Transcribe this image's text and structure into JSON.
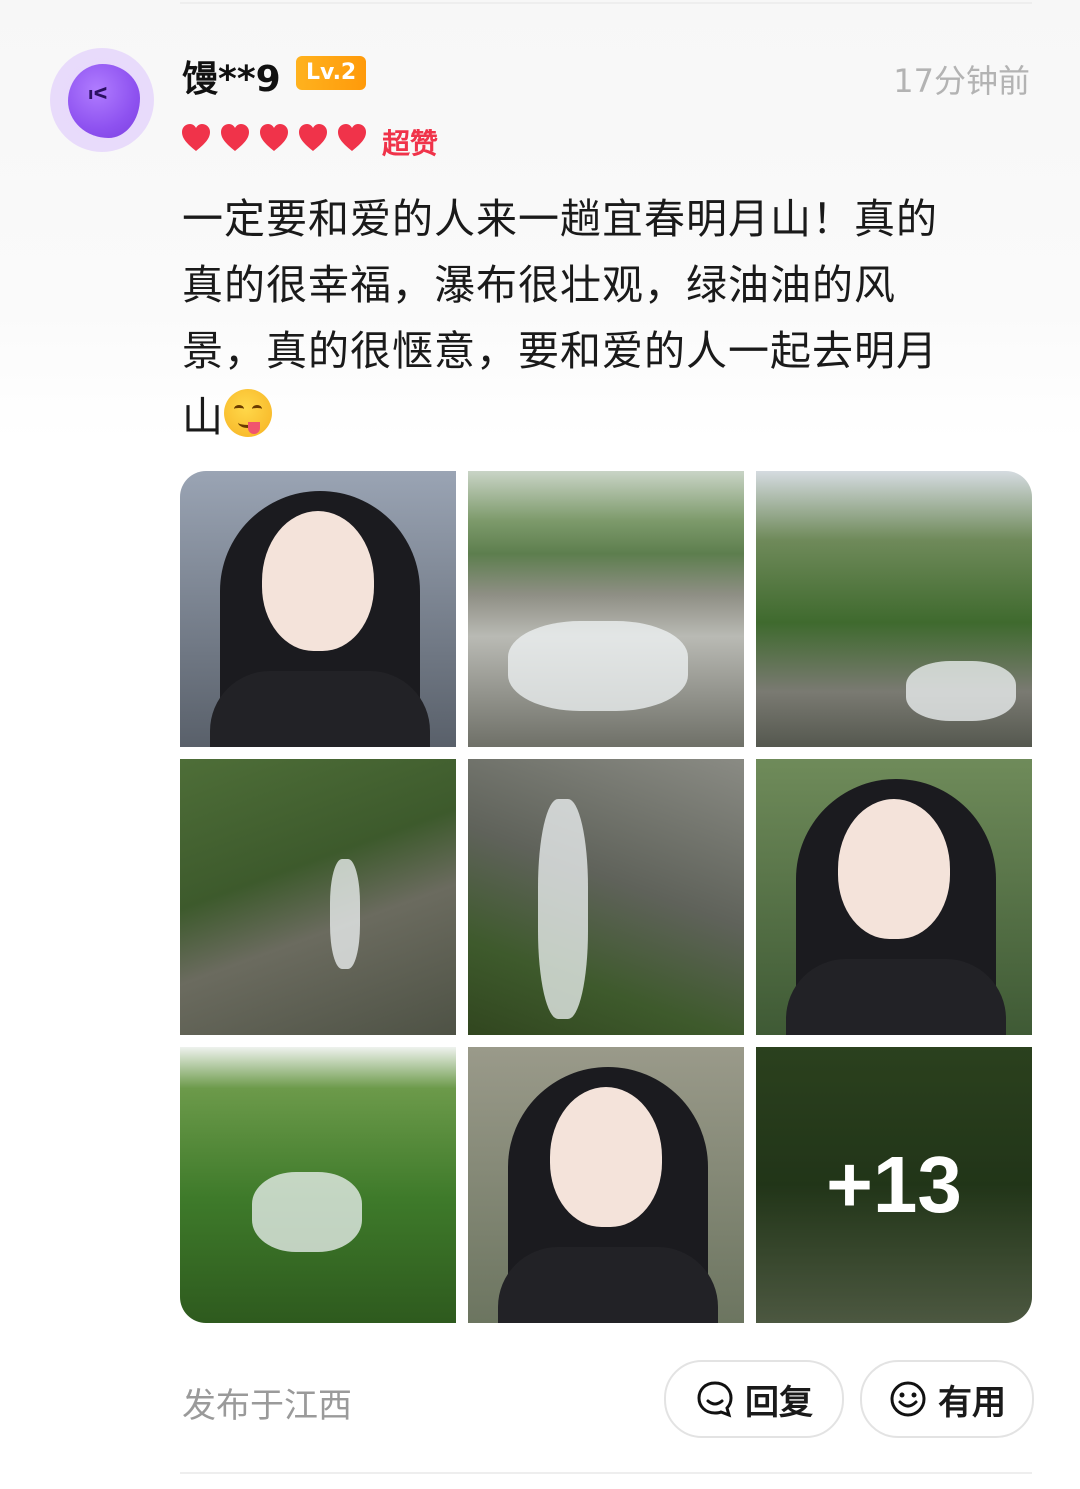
{
  "user": {
    "name": "馒**9",
    "level": "Lv.2",
    "time": "17分钟前",
    "rating_label": "超赞",
    "hearts": 5
  },
  "review": {
    "text_line1": "一定要和爱的人来一趟宜春明月山！真的",
    "text_line2": "真的很幸福，瀑布很壮观，绿油油的风",
    "text_line3": "景，真的很惬意，要和爱的人一起去明月",
    "text_line4": "山"
  },
  "gallery": {
    "more_count": "+13"
  },
  "footer": {
    "location": "发布于江西",
    "reply_label": "回复",
    "useful_label": "有用"
  },
  "colors": {
    "rating": "#f0334a",
    "level_badge": "#ffa514",
    "muted": "#9a9a9a"
  }
}
